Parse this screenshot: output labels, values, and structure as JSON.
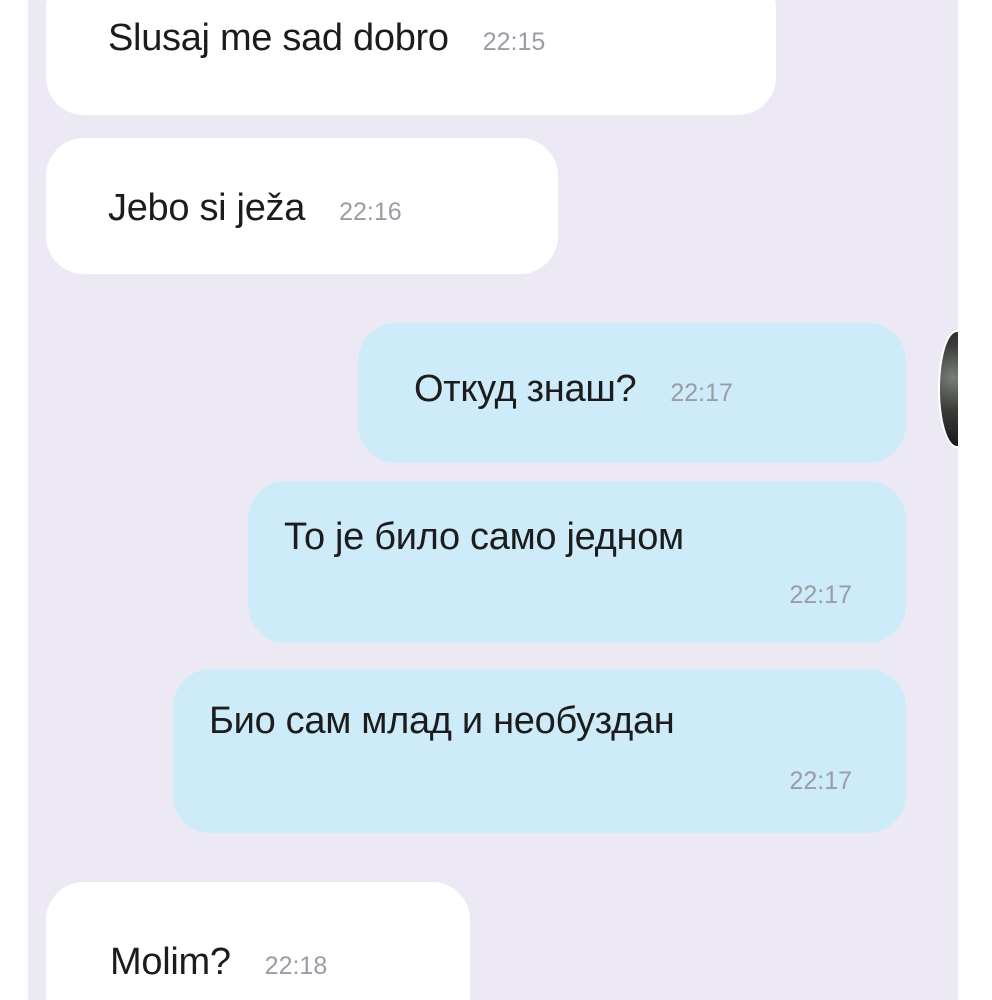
{
  "chat": {
    "messages": [
      {
        "direction": "incoming",
        "text": "Slusaj me sad dobro",
        "time": "22:15"
      },
      {
        "direction": "incoming",
        "text": "Jebo si ježa",
        "time": "22:16"
      },
      {
        "direction": "outgoing",
        "text": "Откуд знаш?",
        "time": "22:17"
      },
      {
        "direction": "outgoing",
        "text": "То је било само једном",
        "time": "22:17"
      },
      {
        "direction": "outgoing",
        "text": "Био сам млад и необуздан",
        "time": "22:17"
      },
      {
        "direction": "incoming",
        "text": "Molim?",
        "time": "22:18"
      }
    ]
  },
  "theme": {
    "chat_background": "#ece9f5",
    "incoming_bubble": "#ffffff",
    "outgoing_bubble": "#cdebf8",
    "timestamp_color": "#9c9ca6"
  },
  "avatar": {
    "icon": "user-avatar-icon"
  }
}
